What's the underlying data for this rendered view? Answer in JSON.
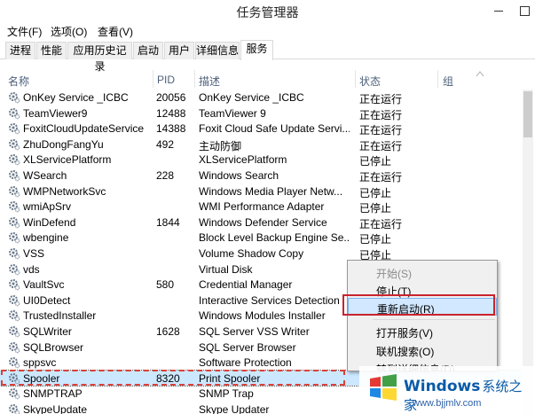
{
  "window": {
    "title": "任务管理器"
  },
  "menu": {
    "file": "文件(F)",
    "options": "选项(O)",
    "view": "查看(V)"
  },
  "tabs": [
    "进程",
    "性能",
    "应用历史记录",
    "启动",
    "用户",
    "详细信息",
    "服务"
  ],
  "active_tab": "服务",
  "columns": {
    "name": "名称",
    "pid": "PID",
    "desc": "描述",
    "status": "状态",
    "group": "组"
  },
  "rows": [
    {
      "name": "OnKey Service _ICBC",
      "pid": "20056",
      "desc": "OnKey Service _ICBC",
      "status": "正在运行"
    },
    {
      "name": "TeamViewer9",
      "pid": "12488",
      "desc": "TeamViewer 9",
      "status": "正在运行"
    },
    {
      "name": "FoxitCloudUpdateService",
      "pid": "14388",
      "desc": "Foxit Cloud Safe Update Servi...",
      "status": "正在运行"
    },
    {
      "name": "ZhuDongFangYu",
      "pid": "492",
      "desc": "主动防御",
      "status": "正在运行"
    },
    {
      "name": "XLServicePlatform",
      "pid": "",
      "desc": "XLServicePlatform",
      "status": "已停止"
    },
    {
      "name": "WSearch",
      "pid": "228",
      "desc": "Windows Search",
      "status": "正在运行"
    },
    {
      "name": "WMPNetworkSvc",
      "pid": "",
      "desc": "Windows Media Player Netw...",
      "status": "已停止"
    },
    {
      "name": "wmiApSrv",
      "pid": "",
      "desc": "WMI Performance Adapter",
      "status": "已停止"
    },
    {
      "name": "WinDefend",
      "pid": "1844",
      "desc": "Windows Defender Service",
      "status": "正在运行"
    },
    {
      "name": "wbengine",
      "pid": "",
      "desc": "Block Level Backup Engine Se...",
      "status": "已停止"
    },
    {
      "name": "VSS",
      "pid": "",
      "desc": "Volume Shadow Copy",
      "status": "已停止"
    },
    {
      "name": "vds",
      "pid": "",
      "desc": "Virtual Disk",
      "status": ""
    },
    {
      "name": "VaultSvc",
      "pid": "580",
      "desc": "Credential Manager",
      "status": ""
    },
    {
      "name": "UI0Detect",
      "pid": "",
      "desc": "Interactive Services Detection",
      "status": ""
    },
    {
      "name": "TrustedInstaller",
      "pid": "",
      "desc": "Windows Modules Installer",
      "status": ""
    },
    {
      "name": "SQLWriter",
      "pid": "1628",
      "desc": "SQL Server VSS Writer",
      "status": ""
    },
    {
      "name": "SQLBrowser",
      "pid": "",
      "desc": "SQL Server Browser",
      "status": ""
    },
    {
      "name": "sppsvc",
      "pid": "",
      "desc": "Software Protection",
      "status": ""
    },
    {
      "name": "Spooler",
      "pid": "8320",
      "desc": "Print Spooler",
      "status": ""
    },
    {
      "name": "SNMPTRAP",
      "pid": "",
      "desc": "SNMP Trap",
      "status": ""
    },
    {
      "name": "SkypeUpdate",
      "pid": "",
      "desc": "Skype Updater",
      "status": ""
    }
  ],
  "selected_row": "Spooler",
  "context_menu": {
    "start": "开始(S)",
    "stop": "停止(T)",
    "restart": "重新启动(R)",
    "open_services": "打开服务(V)",
    "search_online": "联机搜索(O)",
    "go_to_details": "转到详细信息(D)"
  },
  "watermark": {
    "brand": "Windows",
    "brand_cn": "系统之家",
    "url": "www.bjjmlv.com"
  },
  "colors": {
    "header_text": "#4c607a",
    "selection": "#cce8ff",
    "highlight_box": "#c9232d",
    "menu_highlight": "#d1e8ff",
    "watermark_blue": "#0a5aa8"
  }
}
